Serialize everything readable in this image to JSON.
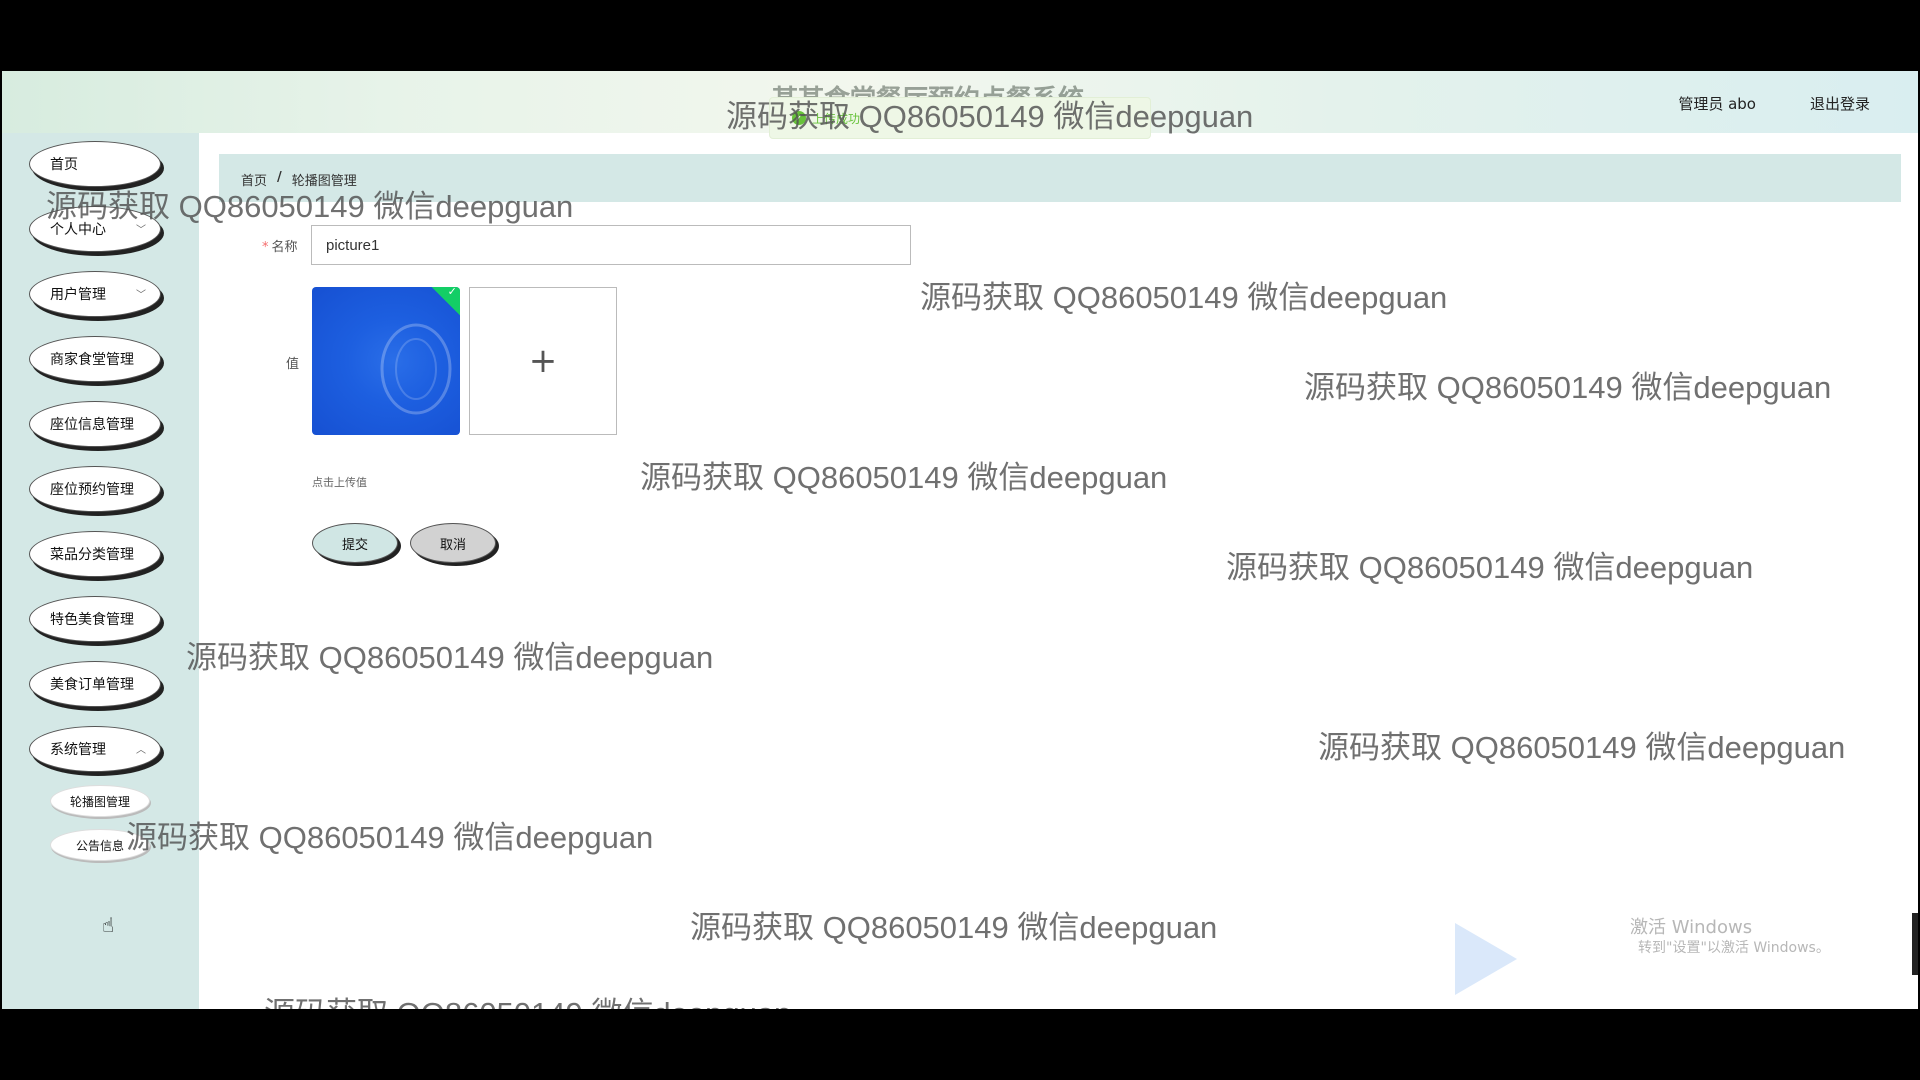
{
  "header": {
    "system_title": "某某食堂餐厅预约点餐系统",
    "toast_message": "上传成功",
    "user_info": "管理员 abo",
    "logout_label": "退出登录"
  },
  "sidebar": {
    "items": [
      {
        "label": "首页"
      },
      {
        "label": "个人中心"
      },
      {
        "label": "用户管理"
      },
      {
        "label": "商家食堂管理"
      },
      {
        "label": "座位信息管理"
      },
      {
        "label": "座位预约管理"
      },
      {
        "label": "菜品分类管理"
      },
      {
        "label": "特色美食管理"
      },
      {
        "label": "美食订单管理"
      },
      {
        "label": "系统管理"
      }
    ],
    "sub_items": [
      {
        "label": "轮播图管理"
      },
      {
        "label": "公告信息"
      }
    ]
  },
  "breadcrumb": {
    "home": "首页",
    "separator": "/",
    "current": "轮播图管理"
  },
  "form": {
    "name_label": "名称",
    "name_value": "picture1",
    "value_label": "值",
    "upload_plus": "+",
    "upload_hint": "点击上传值",
    "submit_label": "提交",
    "cancel_label": "取消"
  },
  "watermark": "源码获取 QQ86050149 微信deepguan",
  "os_overlay": {
    "activate_title": "激活 Windows",
    "activate_sub": "转到\"设置\"以激活 Windows。"
  },
  "colors": {
    "sidebar_bg": "#d4e8e6",
    "accent": "#13ce66",
    "toast_text": "#67c23a",
    "required_star": "#f56c6c"
  }
}
